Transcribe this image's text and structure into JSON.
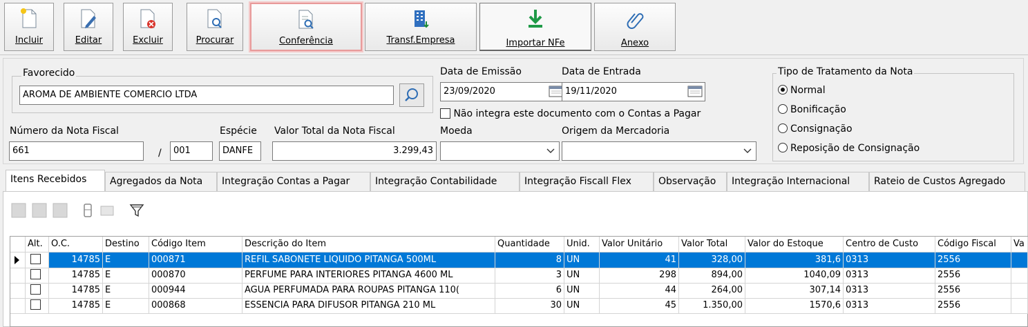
{
  "toolbar": {
    "incluir": "Incluir",
    "editar": "Editar",
    "excluir": "Excluir",
    "procurar": "Procurar",
    "conferencia": "Conferência",
    "transf_empresa": "Transf.Empresa",
    "importar_nfe": "Importar NFe",
    "anexo": "Anexo"
  },
  "form": {
    "favorecido_label": "Favorecido",
    "favorecido_value": "AROMA DE AMBIENTE COMERCIO LTDA",
    "data_emissao_label": "Data de Emissão",
    "data_emissao_value": "23/09/2020",
    "data_entrada_label": "Data de Entrada",
    "data_entrada_value": "19/11/2020",
    "nao_integra_label": "Não integra este documento com o Contas a Pagar",
    "numero_nf_label": "Número da Nota Fiscal",
    "numero_nf_value": "661",
    "serie_sep": "/",
    "serie_value": "001",
    "especie_label": "Espécie",
    "especie_value": "DANFE",
    "valor_total_label": "Valor Total da Nota Fiscal",
    "valor_total_value": "3.299,43",
    "moeda_label": "Moeda",
    "moeda_value": "",
    "origem_label": "Origem da Mercadoria",
    "origem_value": ""
  },
  "tratamento": {
    "title": "Tipo de Tratamento da Nota",
    "options": [
      "Normal",
      "Bonificação",
      "Consignação",
      "Reposição de Consignação"
    ],
    "selected": "Normal"
  },
  "tabs": [
    "Itens Recebidos",
    "Agregados da Nota",
    "Integração Contas a Pagar",
    "Integração Contabilidade",
    "Integração Fiscall Flex",
    "Observação",
    "Integração Internacional",
    "Rateio de Custos Agregado"
  ],
  "grid": {
    "headers": [
      "Alt.",
      "O.C.",
      "Destino",
      "Código Item",
      "Descrição do Item",
      "Quantidade",
      "Unid.",
      "Valor Unitário",
      "Valor Total",
      "Valor do Estoque",
      "Centro de Custo",
      "Código Fiscal",
      "Va"
    ],
    "rows": [
      [
        "14785",
        "E",
        "000871",
        "REFIL SABONETE LIQUIDO PITANGA 500ML",
        "8",
        "UN",
        "41",
        "328,00",
        "381,6",
        "0313",
        "2556"
      ],
      [
        "14785",
        "E",
        "000870",
        "PERFUME PARA INTERIORES PITANGA 4600 ML",
        "3",
        "UN",
        "298",
        "894,00",
        "1040,09",
        "0313",
        "2556"
      ],
      [
        "14785",
        "E",
        "000944",
        "AGUA PERFUMADA PARA ROUPAS PITANGA 110(",
        "6",
        "UN",
        "44",
        "264,00",
        "307,14",
        "0313",
        "2556"
      ],
      [
        "14785",
        "E",
        "000868",
        "ESSENCIA PARA DIFUSOR PITANGA 210 ML",
        "30",
        "UN",
        "45",
        "1.350,00",
        "1570,6",
        "0313",
        "2556"
      ]
    ],
    "selected_row": 0,
    "colors": {
      "selection": "#0078d7"
    }
  }
}
